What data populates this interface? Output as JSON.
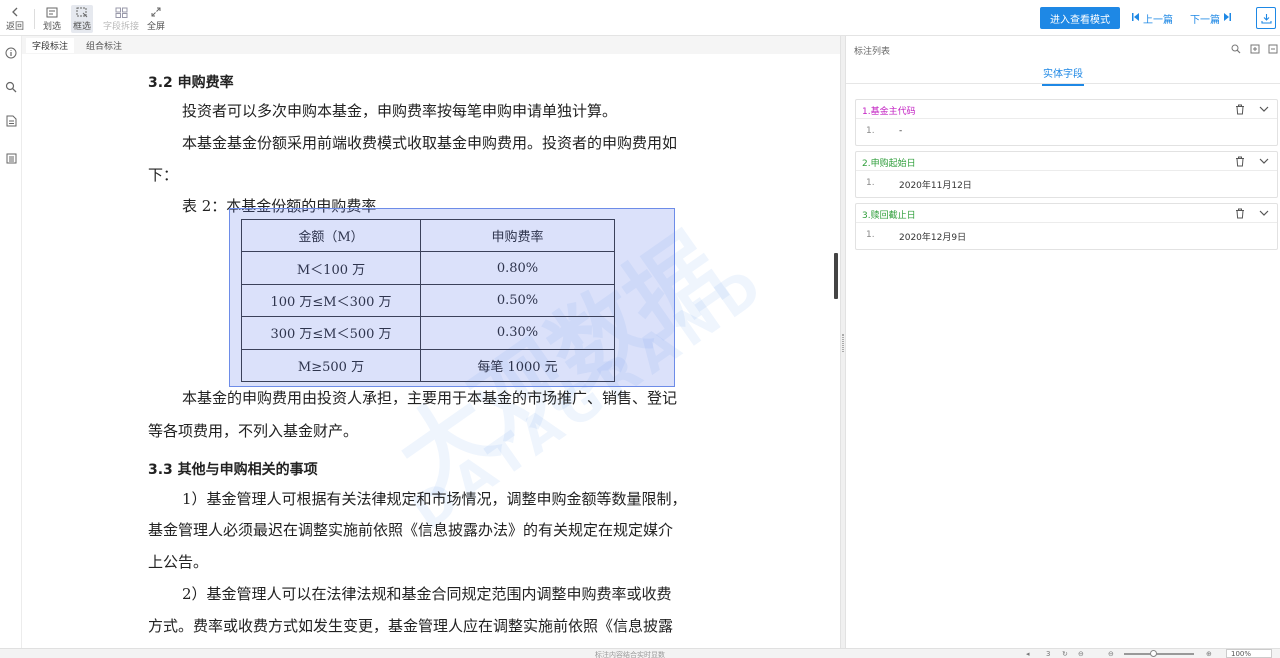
{
  "toolbar": {
    "back": "返回",
    "draw": "划选",
    "box": "框选",
    "cross": "字段拆接",
    "full": "全屏",
    "view_mode": "进入查看模式",
    "prev": "上一篇",
    "next": "下一篇"
  },
  "doc_tabs": {
    "field": "字段标注",
    "combo": "组合标注"
  },
  "document": {
    "sec1_title": "3.2 申购费率",
    "p1": "投资者可以多次申购本基金，申购费率按每笔申购申请单独计算。",
    "p2a": "本基金基金份额采用前端收费模式收取基金申购费用。投资者的申购费用如",
    "p2b": "下：",
    "table_caption": "表 2：本基金份额的申购费率",
    "table": {
      "header": [
        "金额（M）",
        "申购费率"
      ],
      "rows": [
        [
          "M＜100 万",
          "0.80%"
        ],
        [
          "100 万≤M＜300 万",
          "0.50%"
        ],
        [
          "300 万≤M＜500 万",
          "0.30%"
        ],
        [
          "M≥500 万",
          "每笔 1000 元"
        ]
      ]
    },
    "p3a": "本基金的申购费用由投资人承担，主要用于本基金的市场推广、销售、登记",
    "p3b": "等各项费用，不列入基金财产。",
    "sec2_title": "3.3 其他与申购相关的事项",
    "p4a": "1）基金管理人可根据有关法律规定和市场情况，调整申购金额等数量限制，",
    "p4b": "基金管理人必须最迟在调整实施前依照《信息披露办法》的有关规定在规定媒介",
    "p4c": "上公告。",
    "p5a": "2）基金管理人可以在法律法规和基金合同规定范围内调整申购费率或收费",
    "p5b": "方式。费率或收费方式如发生变更，基金管理人应在调整实施前依照《信息披露"
  },
  "watermark": {
    "main": "大观数据",
    "sub": "DATAGRAND"
  },
  "panel": {
    "title": "标注列表",
    "tab": "实体字段",
    "cards": [
      {
        "name": "1.基金主代码",
        "idx": "1.",
        "value": "-",
        "color": "#c21fc2"
      },
      {
        "name": "2.申购起始日",
        "idx": "1.",
        "value": "2020年11月12日",
        "color": "#2e9e3a"
      },
      {
        "name": "3.赎回截止日",
        "idx": "1.",
        "value": "2020年12月9日",
        "color": "#2e9e3a"
      }
    ]
  },
  "status": {
    "hint": "标注内容结合实时显数",
    "page": "3",
    "zoom": "100%"
  }
}
